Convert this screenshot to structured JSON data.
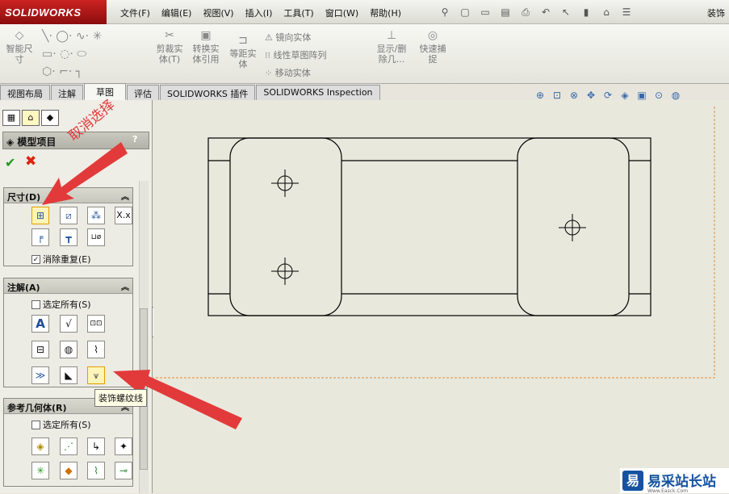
{
  "app": {
    "logo": "SOLIDWORKS",
    "title_right": "装饰"
  },
  "menu": [
    "文件(F)",
    "编辑(E)",
    "视图(V)",
    "插入(I)",
    "工具(T)",
    "窗口(W)",
    "帮助(H)"
  ],
  "ribbon": {
    "smart_dim": "智能尺寸",
    "trim": "剪裁实体(T)",
    "convert": "转换实体引用",
    "offset": "等距实体",
    "mirror": "镜向实体",
    "linear_pattern": "线性草图阵列",
    "move": "移动实体",
    "show_delete": "显示/删除几...",
    "quick_snap": "快速捕捉"
  },
  "tabs": [
    {
      "label": "视图布局",
      "active": false
    },
    {
      "label": "注解",
      "active": false
    },
    {
      "label": "草图",
      "active": true
    },
    {
      "label": "评估",
      "active": false
    },
    {
      "label": "SOLIDWORKS 插件",
      "active": false
    },
    {
      "label": "SOLIDWORKS Inspection",
      "active": false
    }
  ],
  "panel": {
    "title": "模型项目",
    "help": "?",
    "dimensions": {
      "title": "尺寸(D)",
      "eliminate_duplicates": "消除重复(E)",
      "eliminate_checked": true
    },
    "annotations": {
      "title": "注解(A)",
      "select_all": "选定所有(S)"
    },
    "reference_geometry": {
      "title": "参考几何体(R)",
      "select_all": "选定所有(S)"
    }
  },
  "tooltip": "装饰螺纹线",
  "callout": "取消选择",
  "watermark": {
    "logo_char": "易",
    "name": "易采站长站",
    "sub": "Www.Easck.Com"
  },
  "colors": {
    "accent_red": "#e23a3a",
    "logo_red": "#b51414",
    "selection": "#fff5b8"
  }
}
